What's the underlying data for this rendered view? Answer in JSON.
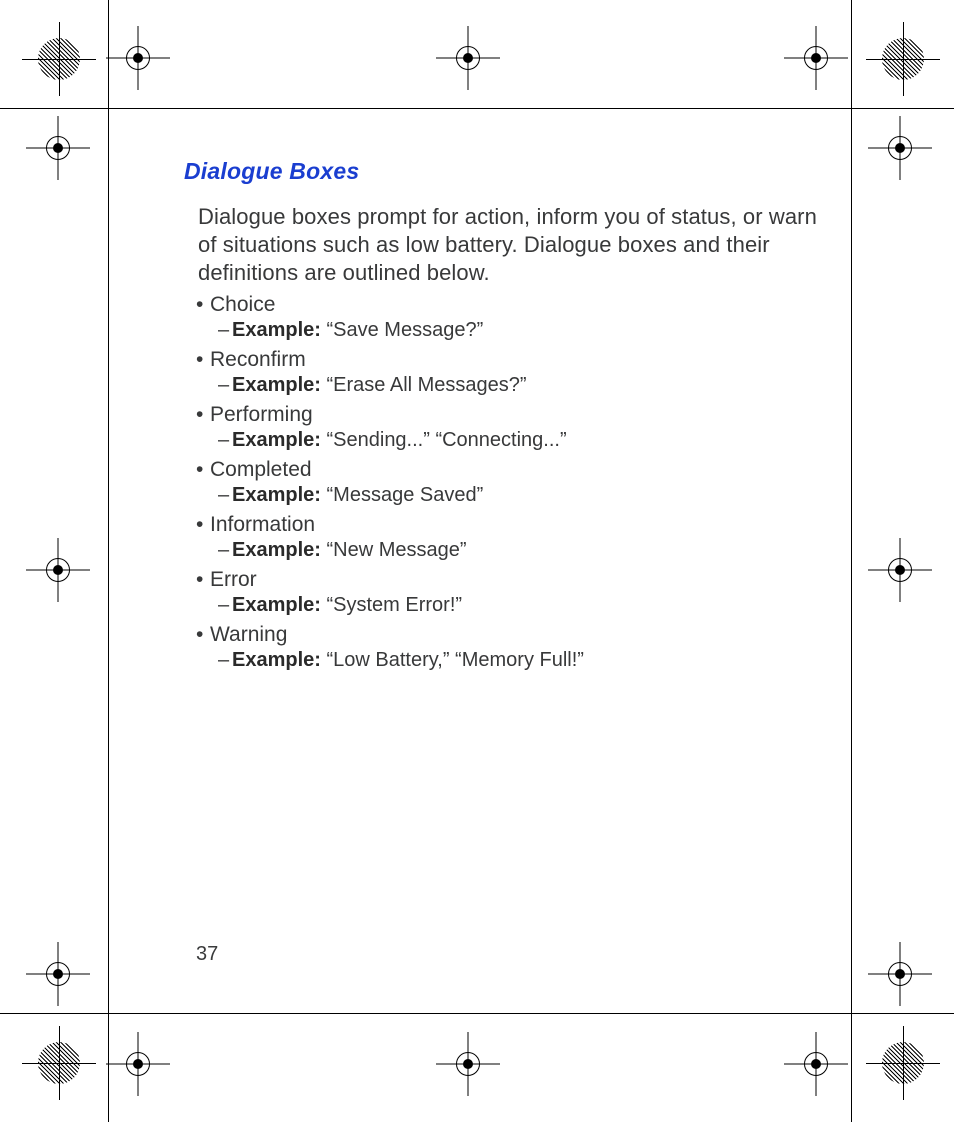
{
  "title": "Dialogue Boxes",
  "intro": "Dialogue boxes prompt for action, inform you of status, or warn of situations such as low battery. Dialogue boxes and their definitions are outlined below.",
  "example_label": "Example:",
  "items": [
    {
      "name": "Choice",
      "example": "“Save Message?”"
    },
    {
      "name": "Reconfirm",
      "example": "“Erase All Messages?”"
    },
    {
      "name": "Performing",
      "example": "“Sending...” “Connecting...”"
    },
    {
      "name": "Completed",
      "example": "“Message Saved”"
    },
    {
      "name": "Information",
      "example": "“New Message”"
    },
    {
      "name": "Error",
      "example": "“System Error!”"
    },
    {
      "name": "Warning",
      "example": "“Low Battery,” “Memory Full!”"
    }
  ],
  "page_number": "37"
}
